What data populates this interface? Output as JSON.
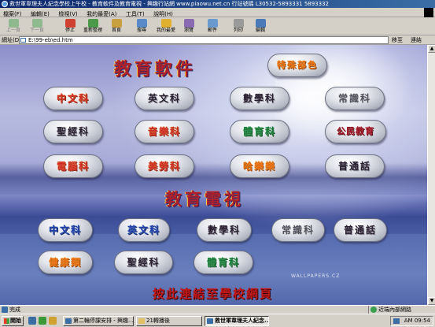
{
  "window": {
    "title": "救世軍韋理夫人紀念學校上午校 - 教育軟件及教育電視 - 興趣行站網 www.piaowu.net.cn 行站號碼 L30532-5893331 5893332"
  },
  "menu": {
    "items": [
      "檔案(F)",
      "編輯(E)",
      "檢視(V)",
      "我的最愛(A)",
      "工具(T)",
      "說明(H)"
    ]
  },
  "toolbar": {
    "back": "上一頁",
    "forward": "下一頁",
    "stop": "停止",
    "refresh": "重新整理",
    "home": "首頁",
    "search": "搜尋",
    "favorites": "我的最愛",
    "history": "瀏覽",
    "mail": "郵件",
    "print": "列印",
    "edit": "編輯"
  },
  "address": {
    "label": "網址(D)",
    "value": "E:\\99-eb\\ed.htm",
    "go": "移至",
    "links": "連結"
  },
  "page": {
    "software_heading": "教育軟件",
    "special_button": "特殊部色",
    "software_buttons": [
      [
        "中文科",
        "英文科",
        "數學科",
        "常識科"
      ],
      [
        "聖經科",
        "音樂科",
        "體育科",
        "公民教育"
      ],
      [
        "電腦科",
        "美勞科",
        "哈樂樂",
        "普通話"
      ]
    ],
    "tv_heading": "教育電視",
    "tv_buttons": [
      [
        "中文科",
        "英文科",
        "數學科",
        "常識科",
        "普通話"
      ],
      [
        "健康類",
        "聖經科",
        "體育科"
      ]
    ],
    "watermark": "WALLPAPERS.CZ",
    "school_link": "按此連結至學校網頁"
  },
  "status": {
    "text": "完成",
    "zone": "近端內部網路"
  },
  "taskbar": {
    "start": "開始",
    "tasks": [
      "第二輪停課安排 - 興趣...",
      "21轉播後",
      "救世軍韋理夫人紀念..."
    ],
    "clock": "AM 09:54"
  },
  "colors": {
    "title_bar": "#0a246a",
    "heading": "#b0202a",
    "link": "#c01818"
  }
}
